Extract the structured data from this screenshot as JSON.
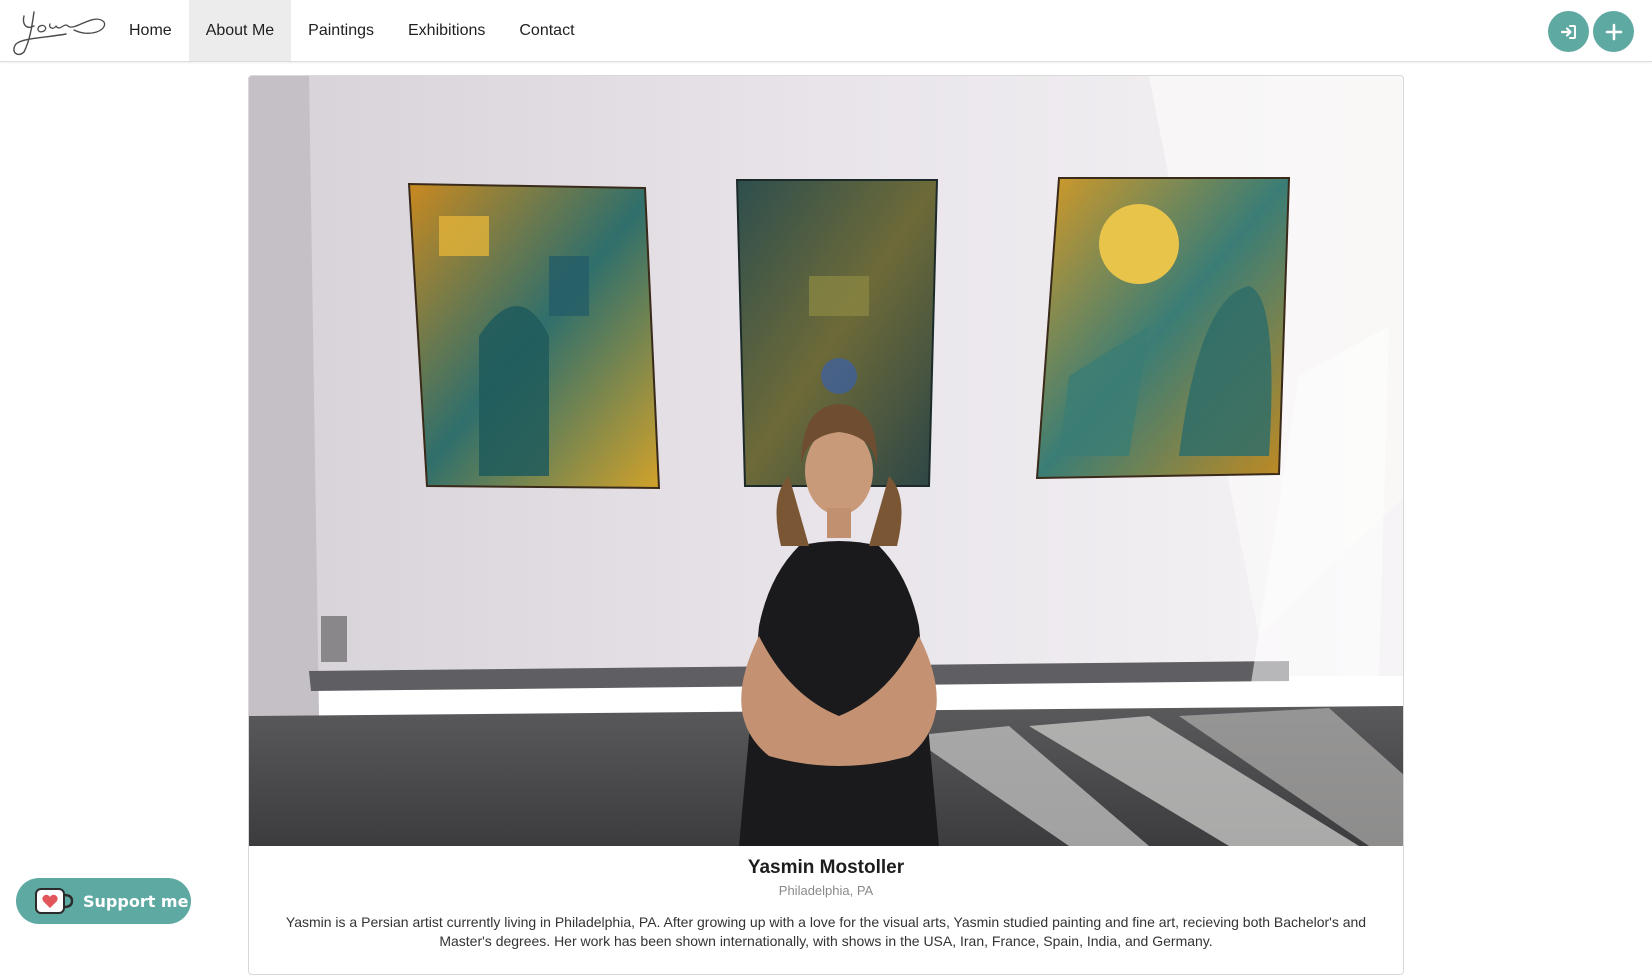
{
  "nav": {
    "logo_alt": "Yasmin signature logo",
    "items": [
      {
        "label": "Home",
        "active": false
      },
      {
        "label": "About Me",
        "active": true
      },
      {
        "label": "Paintings",
        "active": false
      },
      {
        "label": "Exhibitions",
        "active": false
      },
      {
        "label": "Contact",
        "active": false
      }
    ],
    "actions": [
      {
        "icon": "sign-in-icon"
      },
      {
        "icon": "plus-icon"
      }
    ]
  },
  "profile": {
    "photo_alt": "Yasmin Mostoller standing in front of three of her paintings",
    "name": "Yasmin Mostoller",
    "location": "Philadelphia, PA",
    "bio": "Yasmin is a Persian artist currently living in Philadelphia, PA. After growing up with a love for the visual arts, Yasmin studied painting and fine art, recieving both Bachelor's and Master's degrees. Her work has been shown internationally, with shows in the USA, Iran, France, Spain, India, and Germany."
  },
  "support": {
    "label": "Support me",
    "icon": "ko-fi-cup-icon"
  },
  "colors": {
    "accent": "#5fa9a3",
    "nav_active_bg": "#ececec",
    "border": "#d8d8d8"
  }
}
